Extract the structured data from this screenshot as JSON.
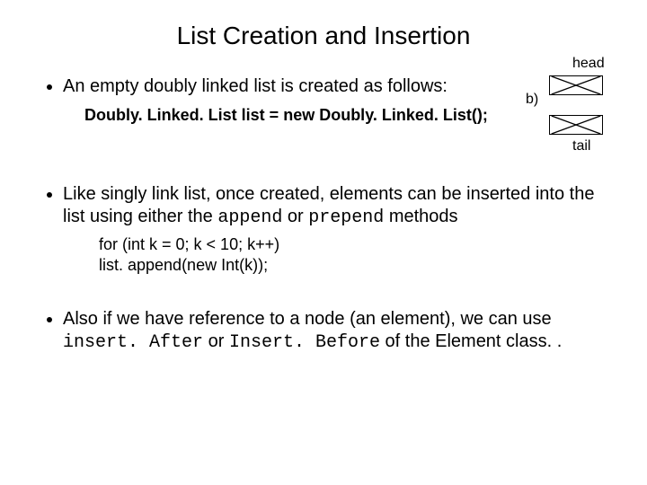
{
  "title": "List Creation and Insertion",
  "bullets": {
    "b1_text": "An empty doubly linked list is created as follows:",
    "b1_code": "Doubly. Linked. List list = new Doubly. Linked. List();",
    "b2_text_a": "Like singly link list, once created, elements can be inserted into the list using either the ",
    "b2_code_a": "append",
    "b2_text_b": " or ",
    "b2_code_b": "prepend",
    "b2_text_c": "  methods",
    "b2_sub1": "for (int k = 0; k < 10; k++)",
    "b2_sub2": "   list. append(new Int(k));",
    "b3_text_a": "Also if we have reference to a node (an element), we can use ",
    "b3_code_a": "insert. After",
    "b3_text_b": " or ",
    "b3_code_b": "Insert. Before",
    "b3_text_c": " of the Element class. ."
  },
  "diagram": {
    "head": "head",
    "b": "b)",
    "tail": "tail"
  }
}
